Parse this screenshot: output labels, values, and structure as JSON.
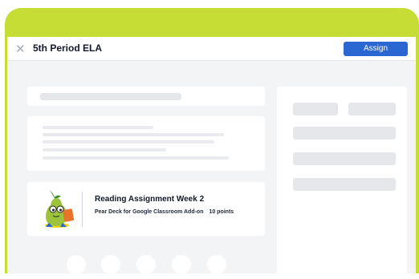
{
  "header": {
    "close_glyph": "✕",
    "class_name": "5th Period ELA",
    "assign_label": "Assign"
  },
  "assignment": {
    "title": "Reading Assignment Week 2",
    "source": "Pear Deck for Google Classroom Add-on",
    "points": "10 points"
  },
  "colors": {
    "frame": "#c5dd35",
    "assign_button": "#2a67d3",
    "background": "#f3f4f6"
  }
}
